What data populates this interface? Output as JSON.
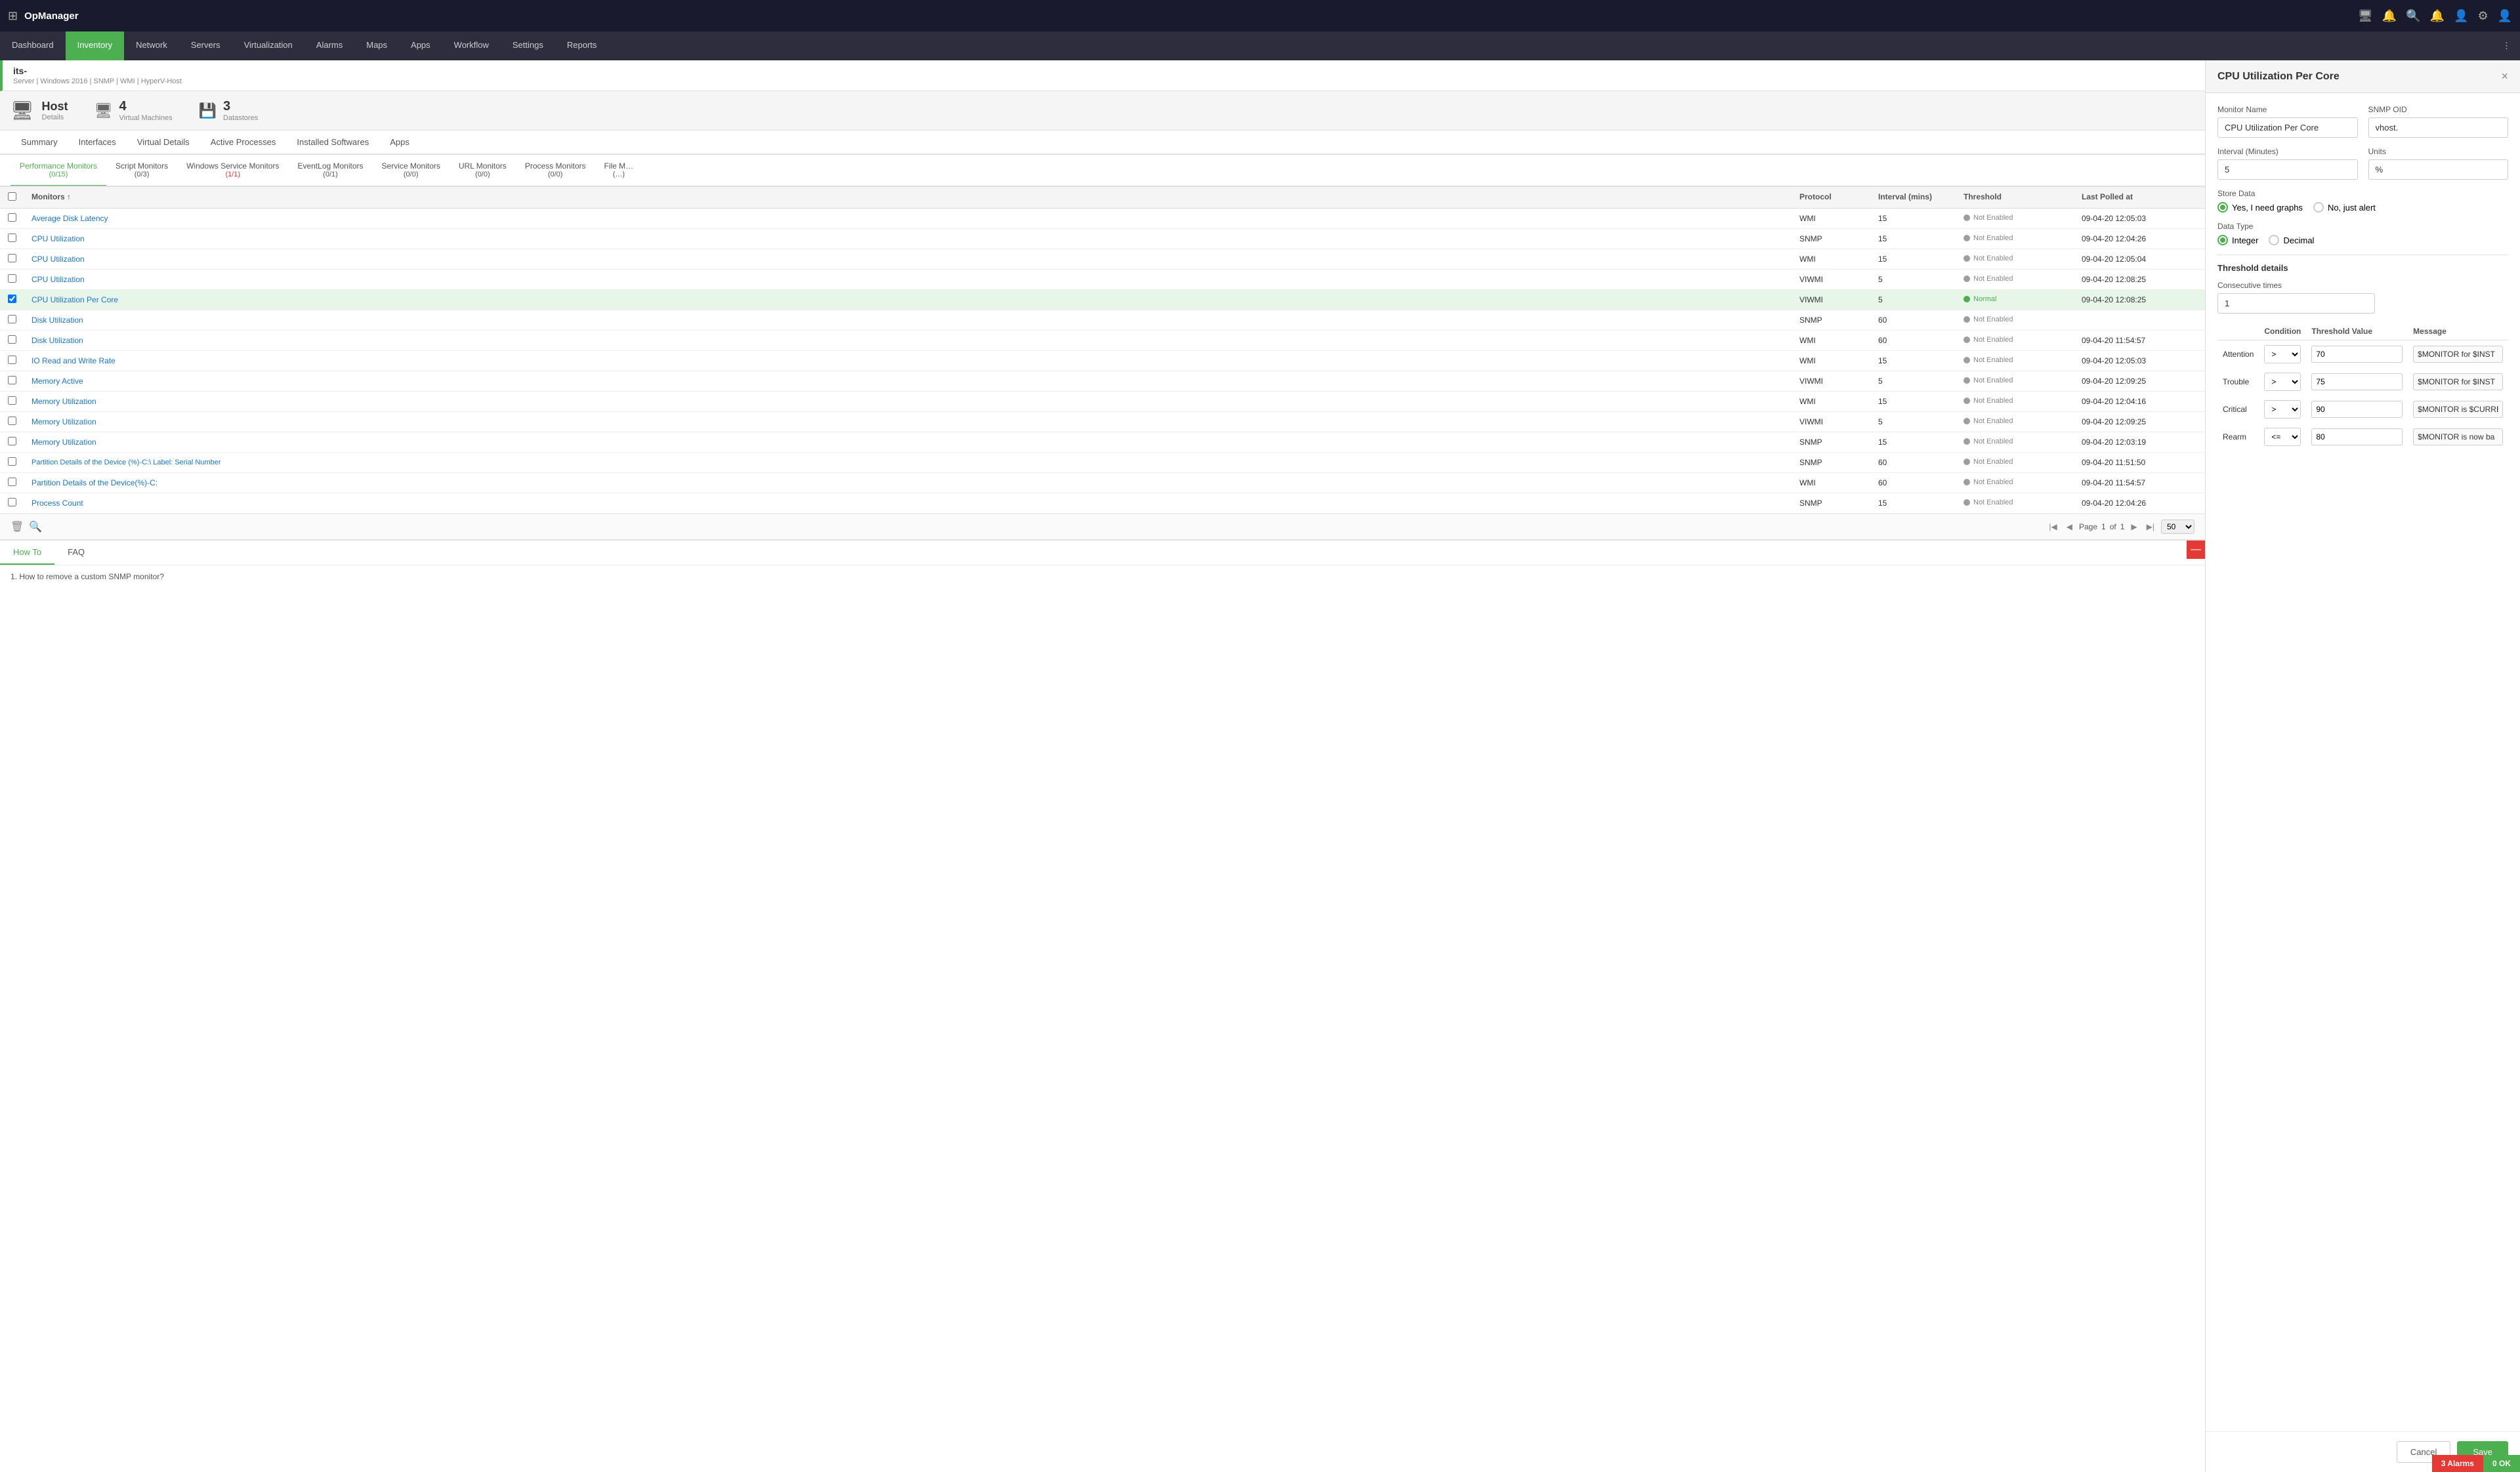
{
  "app": {
    "name": "OpManager",
    "grid_icon": "⊞"
  },
  "topbar": {
    "icons": [
      "monitor-icon",
      "bell-icon",
      "search-icon",
      "notification-icon",
      "user-icon",
      "settings-icon",
      "avatar-icon"
    ]
  },
  "navbar": {
    "items": [
      {
        "id": "dashboard",
        "label": "Dashboard",
        "active": false
      },
      {
        "id": "inventory",
        "label": "Inventory",
        "active": true
      },
      {
        "id": "network",
        "label": "Network",
        "active": false
      },
      {
        "id": "servers",
        "label": "Servers",
        "active": false
      },
      {
        "id": "virtualization",
        "label": "Virtualization",
        "active": false
      },
      {
        "id": "alarms",
        "label": "Alarms",
        "active": false
      },
      {
        "id": "maps",
        "label": "Maps",
        "active": false
      },
      {
        "id": "apps",
        "label": "Apps",
        "active": false
      },
      {
        "id": "workflow",
        "label": "Workflow",
        "active": false
      },
      {
        "id": "settings",
        "label": "Settings",
        "active": false
      },
      {
        "id": "reports",
        "label": "Reports",
        "active": false
      }
    ]
  },
  "breadcrumb": {
    "title": "its-",
    "subtitle": "Server | Windows 2016 | SNMP | WMI | HyperV-Host"
  },
  "host_info": {
    "title": "Host",
    "subtitle": "Details",
    "stats": [
      {
        "icon": "vm-icon",
        "number": "4",
        "label": "Virtual Machines"
      },
      {
        "icon": "datastore-icon",
        "number": "3",
        "label": "Datastores"
      }
    ]
  },
  "subnav": {
    "items": [
      "Summary",
      "Interfaces",
      "Virtual Details",
      "Active Processes",
      "Installed Softwares",
      "Apps"
    ]
  },
  "monitor_tabs": [
    {
      "label": "Performance Monitors",
      "count": "(0/15)",
      "active": true,
      "count_color": "normal"
    },
    {
      "label": "Script Monitors",
      "count": "(0/3)",
      "active": false,
      "count_color": "normal"
    },
    {
      "label": "Windows Service Monitors",
      "count": "(1/1)",
      "active": false,
      "count_color": "red"
    },
    {
      "label": "EventLog Monitors",
      "count": "(0/1)",
      "active": false,
      "count_color": "normal"
    },
    {
      "label": "Service Monitors",
      "count": "(0/0)",
      "active": false,
      "count_color": "normal"
    },
    {
      "label": "URL Monitors",
      "count": "(0/0)",
      "active": false,
      "count_color": "normal"
    },
    {
      "label": "Process Monitors",
      "count": "(0/0)",
      "active": false,
      "count_color": "normal"
    },
    {
      "label": "File M…",
      "count": "(…)",
      "active": false,
      "count_color": "normal"
    }
  ],
  "table": {
    "columns": [
      "",
      "Monitors",
      "Protocol",
      "Interval (mins)",
      "Threshold",
      "Last Polled at"
    ],
    "rows": [
      {
        "id": 1,
        "name": "Average Disk Latency",
        "protocol": "WMI",
        "interval": "15",
        "threshold": "Not Enabled",
        "threshold_type": "grey",
        "last_polled": "09-04-20 12:05:03",
        "selected": false
      },
      {
        "id": 2,
        "name": "CPU Utilization",
        "protocol": "SNMP",
        "interval": "15",
        "threshold": "Not Enabled",
        "threshold_type": "grey",
        "last_polled": "09-04-20 12:04:26",
        "selected": false
      },
      {
        "id": 3,
        "name": "CPU Utilization",
        "protocol": "WMI",
        "interval": "15",
        "threshold": "Not Enabled",
        "threshold_type": "grey",
        "last_polled": "09-04-20 12:05:04",
        "selected": false
      },
      {
        "id": 4,
        "name": "CPU Utilization",
        "protocol": "VIWMI",
        "interval": "5",
        "threshold": "Not Enabled",
        "threshold_type": "grey",
        "last_polled": "09-04-20 12:08:25",
        "selected": false
      },
      {
        "id": 5,
        "name": "CPU Utilization Per Core",
        "protocol": "VIWMI",
        "interval": "5",
        "threshold": "Normal",
        "threshold_type": "green",
        "last_polled": "09-04-20 12:08:25",
        "selected": true
      },
      {
        "id": 6,
        "name": "Disk Utilization",
        "protocol": "SNMP",
        "interval": "60",
        "threshold": "Not Enabled",
        "threshold_type": "grey",
        "last_polled": "",
        "selected": false
      },
      {
        "id": 7,
        "name": "Disk Utilization",
        "protocol": "WMI",
        "interval": "60",
        "threshold": "Not Enabled",
        "threshold_type": "grey",
        "last_polled": "09-04-20 11:54:57",
        "selected": false
      },
      {
        "id": 8,
        "name": "IO Read and Write Rate",
        "protocol": "WMI",
        "interval": "15",
        "threshold": "Not Enabled",
        "threshold_type": "grey",
        "last_polled": "09-04-20 12:05:03",
        "selected": false
      },
      {
        "id": 9,
        "name": "Memory Active",
        "protocol": "VIWMI",
        "interval": "5",
        "threshold": "Not Enabled",
        "threshold_type": "grey",
        "last_polled": "09-04-20 12:09:25",
        "selected": false
      },
      {
        "id": 10,
        "name": "Memory Utilization",
        "protocol": "WMI",
        "interval": "15",
        "threshold": "Not Enabled",
        "threshold_type": "grey",
        "last_polled": "09-04-20 12:04:16",
        "selected": false
      },
      {
        "id": 11,
        "name": "Memory Utilization",
        "protocol": "VIWMI",
        "interval": "5",
        "threshold": "Not Enabled",
        "threshold_type": "grey",
        "last_polled": "09-04-20 12:09:25",
        "selected": false
      },
      {
        "id": 12,
        "name": "Memory Utilization",
        "protocol": "SNMP",
        "interval": "15",
        "threshold": "Not Enabled",
        "threshold_type": "grey",
        "last_polled": "09-04-20 12:03:19",
        "selected": false
      },
      {
        "id": 13,
        "name": "Partition Details of the Device (%)-C:\\ Label: Serial Number",
        "protocol": "SNMP",
        "interval": "60",
        "threshold": "Not Enabled",
        "threshold_type": "grey",
        "last_polled": "09-04-20 11:51:50",
        "selected": false
      },
      {
        "id": 14,
        "name": "Partition Details of the Device(%)-C:",
        "protocol": "WMI",
        "interval": "60",
        "threshold": "Not Enabled",
        "threshold_type": "grey",
        "last_polled": "09-04-20 11:54:57",
        "selected": false
      },
      {
        "id": 15,
        "name": "Process Count",
        "protocol": "SNMP",
        "interval": "15",
        "threshold": "Not Enabled",
        "threshold_type": "grey",
        "last_polled": "09-04-20 12:04:26",
        "selected": false
      }
    ],
    "pagination": {
      "page_label": "Page",
      "current_page": "1",
      "of_label": "of",
      "total_pages": "1",
      "per_page": "50"
    }
  },
  "bottom_panel": {
    "tabs": [
      {
        "label": "How To",
        "active": true
      },
      {
        "label": "FAQ",
        "active": false
      }
    ],
    "content": "1. How to remove a custom SNMP monitor?"
  },
  "modal": {
    "title": "CPU Utilization Per Core",
    "close_label": "×",
    "monitor_name_label": "Monitor Name",
    "monitor_name_value": "CPU Utilization Per Core",
    "snmp_oid_label": "SNMP OID",
    "snmp_oid_value": "vhost.",
    "interval_label": "Interval (Minutes)",
    "interval_value": "5",
    "units_label": "Units",
    "units_value": "%",
    "store_data_label": "Store Data",
    "store_data_options": [
      {
        "label": "Yes, I need graphs",
        "active": true
      },
      {
        "label": "No, just alert",
        "active": false
      }
    ],
    "data_type_label": "Data Type",
    "data_type_options": [
      {
        "label": "Integer",
        "active": true
      },
      {
        "label": "Decimal",
        "active": false
      }
    ],
    "threshold_section_label": "Threshold details",
    "consecutive_times_label": "Consecutive times",
    "consecutive_times_value": "1",
    "threshold_columns": [
      "",
      "Condition",
      "Threshold Value",
      "Message"
    ],
    "threshold_rows": [
      {
        "label": "Attention",
        "condition": ">",
        "value": "70",
        "message": "$MONITOR for $INST"
      },
      {
        "label": "Trouble",
        "condition": ">",
        "value": "75",
        "message": "$MONITOR for $INST"
      },
      {
        "label": "Critical",
        "condition": ">",
        "value": "90",
        "message": "$MONITOR is $CURRE"
      },
      {
        "label": "Rearm",
        "condition": "<=",
        "value": "80",
        "message": "$MONITOR is now ba"
      }
    ],
    "cancel_label": "Cancel",
    "save_label": "Save"
  },
  "bottom_notif": {
    "alarms": {
      "count": "3",
      "label": "Alarms"
    },
    "ok": {
      "count": "0",
      "label": "OK"
    }
  }
}
